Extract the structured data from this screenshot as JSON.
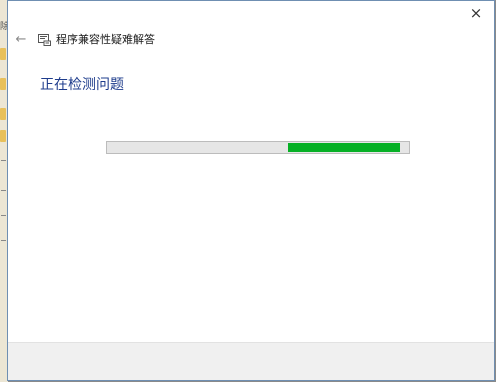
{
  "window": {
    "close_glyph": "×",
    "nav": {
      "back_glyph": "←",
      "icon": "troubleshooter-icon",
      "title": "程序兼容性疑难解答"
    },
    "heading": "正在检测问题",
    "progress": {
      "start_fraction": 0.6,
      "end_fraction": 0.97,
      "fill_color": "#06b025",
      "track_color": "#e6e6e6"
    }
  },
  "background": {
    "edge_glyph": "除"
  },
  "colors": {
    "heading": "#1e3c8c",
    "window_border": "#6f8fb2",
    "footer": "#f0f0f0"
  }
}
